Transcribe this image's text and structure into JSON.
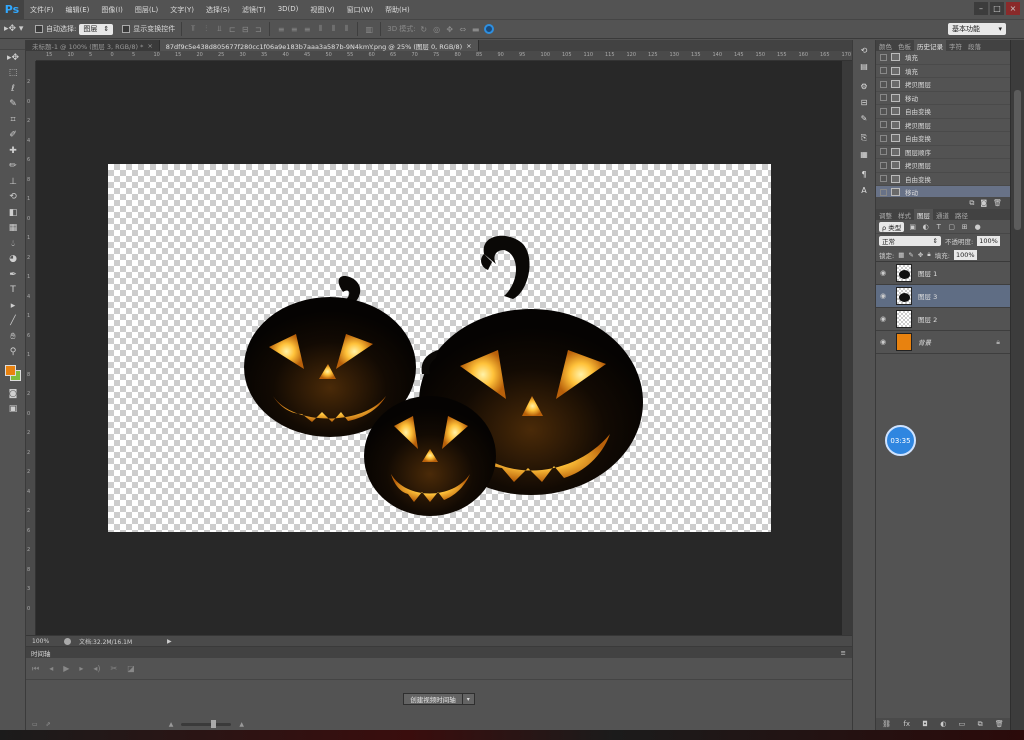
{
  "app": {
    "logo": "Ps"
  },
  "menu": [
    "文件(F)",
    "编辑(E)",
    "图像(I)",
    "图层(L)",
    "文字(Y)",
    "选择(S)",
    "滤镜(T)",
    "3D(D)",
    "视图(V)",
    "窗口(W)",
    "帮助(H)"
  ],
  "window_buttons": {
    "minimize": "–",
    "maximize": "□",
    "close": "×"
  },
  "options": {
    "auto_select_label": "自动选择:",
    "auto_select_value": "图层",
    "show_transform_label": "显示变换控件",
    "mode_3d_label": "3D 模式:",
    "workspace": "基本功能"
  },
  "tools": [
    "move",
    "marquee",
    "lasso",
    "quick-select",
    "crop",
    "eyedropper",
    "healing",
    "brush",
    "stamp",
    "history-brush",
    "eraser",
    "gradient",
    "blur",
    "dodge",
    "pen",
    "type",
    "path-select",
    "shape",
    "hand",
    "zoom"
  ],
  "colors": {
    "foreground": "#e8820f",
    "background": "#7cbd3d",
    "active_row": "#687287",
    "active_layer": "#5f6d84"
  },
  "tabs": [
    {
      "label": "未标题-1 @ 100% (图层 3, RGB/8) *",
      "close": "×"
    },
    {
      "label": "87df9c5e438d805677f280cc1f06a9e183b7aaa3a587b-9N4kmY.png @ 25% (图层 0, RGB/8)",
      "close": "×"
    }
  ],
  "ruler_h": [
    "15",
    "10",
    "5",
    "0",
    "5",
    "10",
    "15",
    "20",
    "25",
    "30",
    "35",
    "40",
    "45",
    "50",
    "55",
    "60",
    "65",
    "70",
    "75",
    "80",
    "85",
    "90",
    "95",
    "100",
    "105",
    "110",
    "115",
    "120",
    "125",
    "130",
    "135",
    "140",
    "145",
    "150",
    "155",
    "160",
    "165",
    "170"
  ],
  "ruler_v": [
    "2",
    "0",
    "2",
    "4",
    "6",
    "8",
    "1",
    "0",
    "1",
    "2",
    "1",
    "4",
    "1",
    "6",
    "1",
    "8",
    "2",
    "0",
    "2",
    "2",
    "2",
    "4",
    "2",
    "6",
    "2",
    "8",
    "3",
    "0"
  ],
  "status": {
    "zoom": "100%",
    "doc": "文档:32.2M/16.1M",
    "arrow": "▶"
  },
  "timeline": {
    "title": "时间轴",
    "menu": "≡",
    "create_label": "创建视频时间轴",
    "dropdown": "▾"
  },
  "panel_tabs_top": [
    "颜色",
    "色板",
    "历史记录",
    "字符",
    "段落"
  ],
  "history": [
    "填充",
    "填充",
    "拷贝图层",
    "移动",
    "自由变换",
    "拷贝图层",
    "自由变换",
    "图层顺序",
    "拷贝图层",
    "自由变换",
    "移动"
  ],
  "history_active_index": 10,
  "panel_tabs_layers": [
    "调整",
    "样式",
    "图层",
    "通道",
    "路径"
  ],
  "layers_panel": {
    "filter_kind": "ρ 类型",
    "blend_mode": "正常",
    "opacity_label": "不透明度:",
    "opacity_value": "100%",
    "lock_label": "锁定:",
    "fill_label": "填充:",
    "fill_value": "100%"
  },
  "layers": [
    {
      "name": "图层 1",
      "type": "pumpkin",
      "active": false
    },
    {
      "name": "图层 3",
      "type": "pumpkin",
      "active": true
    },
    {
      "name": "图层 2",
      "type": "empty",
      "active": false
    },
    {
      "name": "背景",
      "type": "background",
      "active": false
    }
  ],
  "timer": "03:35"
}
